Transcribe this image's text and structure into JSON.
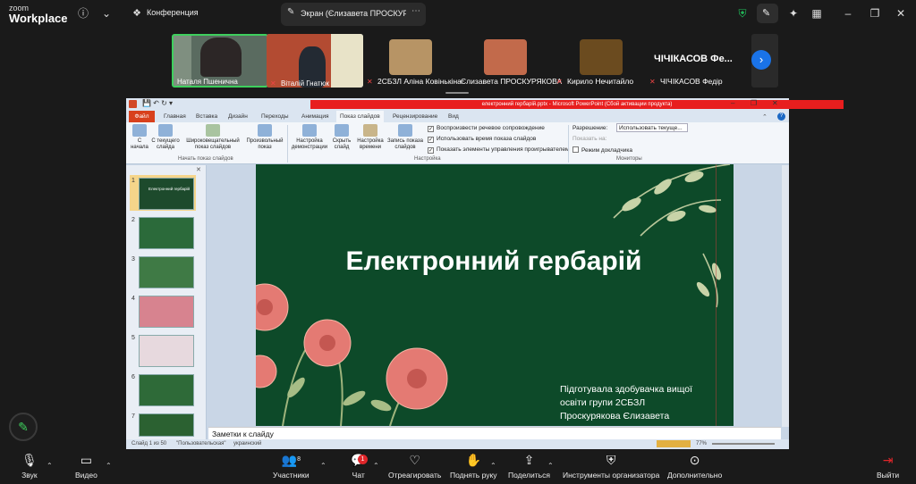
{
  "app": {
    "logo_top": "zoom",
    "logo_bottom": "Workplace",
    "meeting_label": "Конференция",
    "share_label": "Экран (Єлизавета ПРОСКУРЯКО"
  },
  "participants": [
    {
      "name": "Наталя Пшенична",
      "muted": false
    },
    {
      "name": "Віталій Гнатюк",
      "muted": true
    },
    {
      "name": "2СБЗЛ Аліна Ковінькіна",
      "muted": true
    },
    {
      "name": "Єлизавета ПРОСКУРЯКОВА",
      "muted": false
    },
    {
      "name": "Кирило Нечитайло",
      "muted": true
    },
    {
      "name": "ЧІЧІКАСОВ Федір",
      "muted": true
    }
  ],
  "big_name_tile": "ЧІЧІКАСОВ Фе...",
  "ppt": {
    "title": "електронний гербарій.pptx - Microsoft PowerPoint (Сбой активации продукта)",
    "tabs": [
      "Файл",
      "Главная",
      "Вставка",
      "Дизайн",
      "Переходы",
      "Анимация",
      "Показ слайдов",
      "Рецензирование",
      "Вид"
    ],
    "ribbon": {
      "b1": "С начала",
      "b2": "С текущего слайда",
      "b3": "Широковещательный показ слайдов",
      "b4": "Произвольный показ",
      "b5": "Настройка демонстрации",
      "b6": "Скрыть слайд",
      "b7": "Настройка времени",
      "b8": "Запись показа слайдов",
      "c1": "Воспроизвести речевое сопровождение",
      "c2": "Использовать время показа слайдов",
      "c3": "Показать элементы управления проигрывателем",
      "r1": "Разрешение:",
      "r1v": "Использовать текуще...",
      "r2": "Показать на:",
      "r3": "Режим докладчика",
      "g1": "Начать показ слайдов",
      "g2": "Настройка",
      "g3": "Мониторы"
    },
    "slide_title": "Електронний гербарій",
    "slide_caption": [
      "Підготувала здобувачка вищої",
      "освіти  групи 2СБЗЛ",
      "Проскурякова Єлизавета"
    ],
    "thumb1_title": "Електронний гербарій",
    "slide_numbers": [
      "1",
      "2",
      "3",
      "4",
      "5",
      "6",
      "7"
    ],
    "notes": "Заметки к слайду",
    "status_slide": "Слайд 1 из 50",
    "status_theme": "\"Пользовательская\"",
    "status_lang": "украинский",
    "zoom": "77%"
  },
  "toolbar": {
    "audio": "Звук",
    "video": "Видео",
    "participants": "Участники",
    "participants_count": "8",
    "chat": "Чат",
    "chat_badge": "1",
    "react": "Отреагировать",
    "raise": "Поднять руку",
    "share": "Поделиться",
    "host_tools": "Инструменты организатора",
    "more": "Дополнительно",
    "leave": "Выйти"
  },
  "colors": {
    "slide_bg": "#0d4a29",
    "accent_blue": "#1a73e8",
    "leave_red": "#e0262a",
    "file_tab": "#d8401c"
  }
}
